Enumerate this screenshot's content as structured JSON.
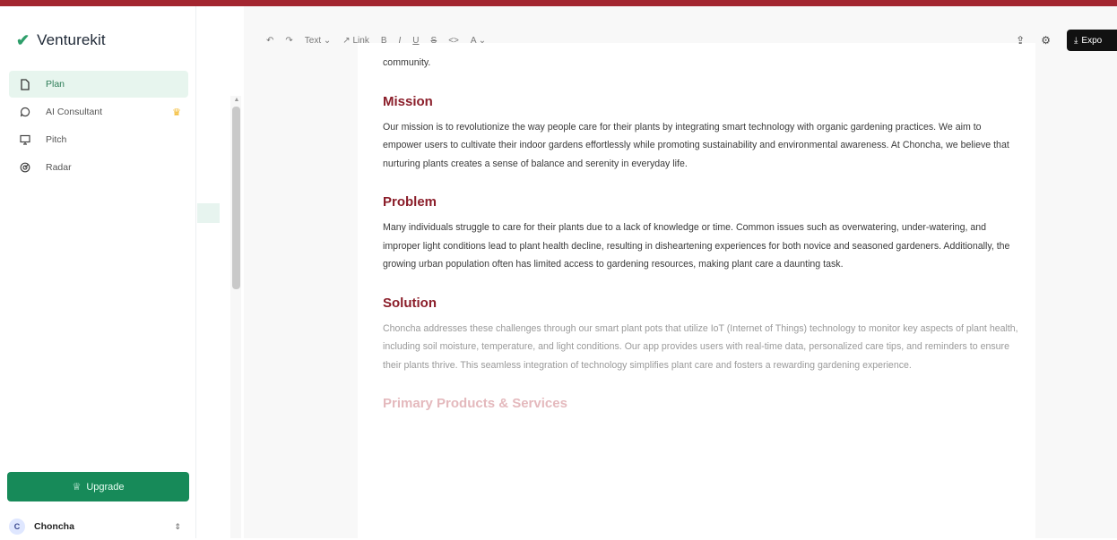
{
  "brand": {
    "logo_icon": "v-logo-icon",
    "name": "Venturekit"
  },
  "sidebar": {
    "items": [
      {
        "label": "Plan",
        "icon": "document-icon",
        "active": true
      },
      {
        "label": "AI Consultant",
        "icon": "chat-bubble-icon",
        "badge": "crown-icon"
      },
      {
        "label": "Pitch",
        "icon": "presentation-icon"
      },
      {
        "label": "Radar",
        "icon": "radar-icon"
      }
    ],
    "upgrade_label": "Upgrade",
    "user": {
      "initial": "C",
      "name": "Choncha"
    }
  },
  "toolbar": {
    "text_label": "Text",
    "link_label": "Link",
    "bold_label": "B",
    "italic_label": "I",
    "underline_label": "U",
    "strike_label": "S",
    "code_label": "<>",
    "color_label": "A",
    "export_label": "Expo"
  },
  "document": {
    "intro_tail": "community.",
    "sections": [
      {
        "heading": "Mission",
        "body": "Our mission is to revolutionize the way people care for their plants by integrating smart technology with organic gardening practices. We aim to empower users to cultivate their indoor gardens effortlessly while promoting sustainability and environmental awareness. At Choncha, we believe that nurturing plants creates a sense of balance and serenity in everyday life."
      },
      {
        "heading": "Problem",
        "body": "Many individuals struggle to care for their plants due to a lack of knowledge or time. Common issues such as overwatering, under-watering, and improper light conditions lead to plant health decline, resulting in disheartening experiences for both novice and seasoned gardeners. Additionally, the growing urban population often has limited access to gardening resources, making plant care a daunting task."
      },
      {
        "heading": "Solution",
        "body": "Choncha addresses these challenges through our smart plant pots that utilize IoT (Internet of Things) technology to monitor key aspects of plant health, including soil moisture, temperature, and light conditions. Our app provides users with real-time data, personalized care tips, and reminders to ensure their plants thrive. This seamless integration of technology simplifies plant care and fosters a rewarding gardening experience."
      },
      {
        "heading": "Primary Products & Services",
        "body": ""
      }
    ]
  }
}
